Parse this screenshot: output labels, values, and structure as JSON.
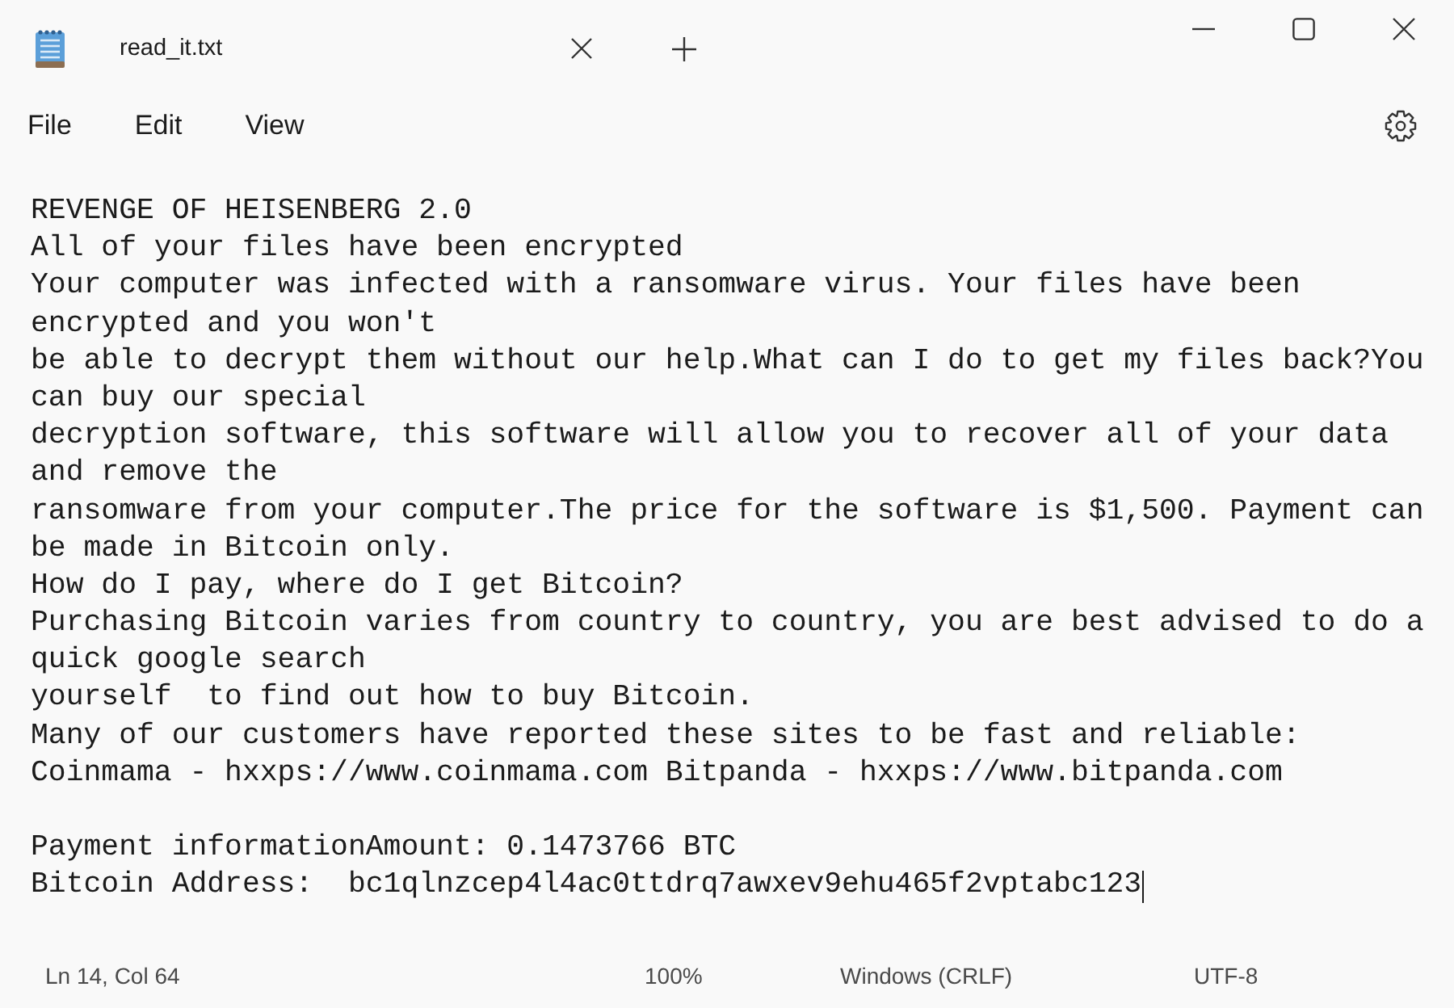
{
  "tab": {
    "title": "read_it.txt"
  },
  "menu": [
    "File",
    "Edit",
    "View"
  ],
  "document": {
    "cursor_at_end": true,
    "paragraphs": [
      {
        "lines": [
          "REVENGE OF HEISENBERG 2.0",
          "All of your files have been encrypted",
          "Your computer was infected with a ransomware virus. Your files have been",
          "encrypted and you won't",
          "be able to decrypt them without our help.What can I do to get my files back?You",
          "can buy our special",
          "decryption software, this software will allow you to recover all of your data",
          "and remove the",
          "ransomware from your computer.The price for the software is $1,500. Payment can",
          "be made in Bitcoin only.",
          "How do I pay, where do I get Bitcoin?",
          "Purchasing Bitcoin varies from country to country, you are best advised to do a",
          "quick google search",
          "yourself  to find out how to buy Bitcoin.",
          "Many of our customers have reported these sites to be fast and reliable:",
          "Coinmama - hxxps://www.coinmama.com Bitpanda - hxxps://www.bitpanda.com"
        ]
      },
      {
        "lines": [
          "Payment informationAmount: 0.1473766 BTC",
          "Bitcoin Address:  bc1qlnzcep4l4ac0ttdrq7awxev9ehu465f2vptabc123"
        ]
      }
    ]
  },
  "status_bar": {
    "position": "Ln 14, Col 64",
    "zoom": "100%",
    "line_ending": "Windows (CRLF)",
    "encoding": "UTF-8"
  }
}
